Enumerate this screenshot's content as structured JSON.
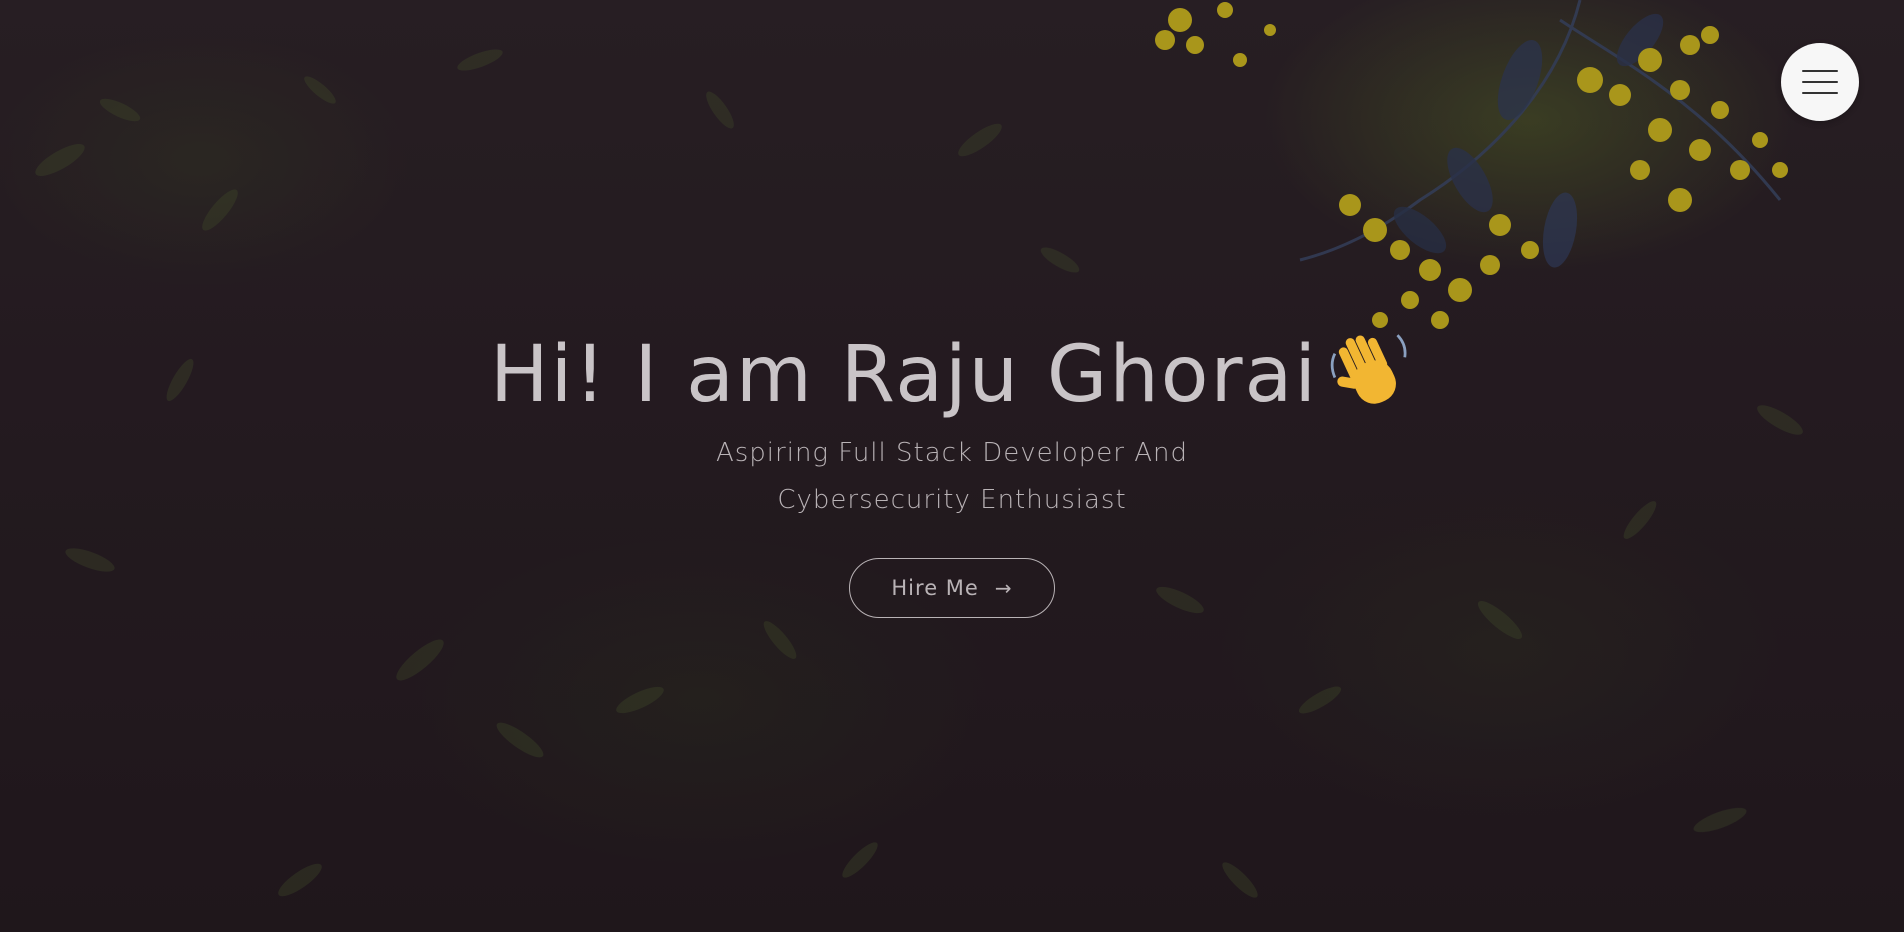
{
  "hero": {
    "title": "Hi! I am Raju Ghorai",
    "title_emoji_icon": "waving-hand-icon",
    "subtitle_line1": "Aspiring Full Stack Developer And",
    "subtitle_line2": "Cybersecurity Enthusiast",
    "cta_label": "Hire Me",
    "cta_arrow": "→"
  },
  "nav": {
    "menu_icon": "hamburger-icon"
  },
  "colors": {
    "background": "#231a20",
    "text": "#c9c4c7",
    "menu_button_bg": "#f7f7f7",
    "flower_yellow": "#d9c21c",
    "emoji_yellow": "#f2b632"
  }
}
